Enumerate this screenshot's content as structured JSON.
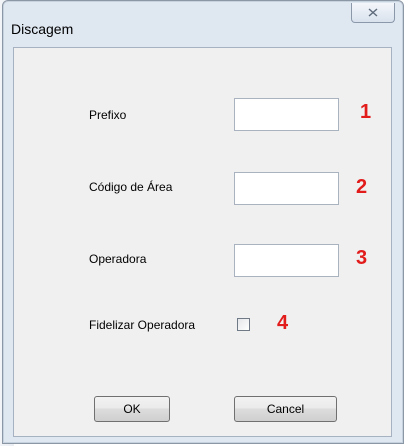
{
  "window": {
    "title": "Discagem"
  },
  "form": {
    "fields": [
      {
        "label": "Prefixo",
        "value": "",
        "marker": "1"
      },
      {
        "label": "Código de Área",
        "value": "",
        "marker": "2"
      },
      {
        "label": "Operadora",
        "value": "",
        "marker": "3"
      }
    ],
    "checkbox": {
      "label": "Fidelizar Operadora",
      "checked": false,
      "marker": "4"
    }
  },
  "buttons": {
    "ok_label": "OK",
    "cancel_label": "Cancel"
  },
  "colors": {
    "marker": "#e21b1b",
    "window_frame": "#dfe7f1",
    "client_bg": "#f0f0f0"
  },
  "icons": {
    "close": "close-icon"
  }
}
